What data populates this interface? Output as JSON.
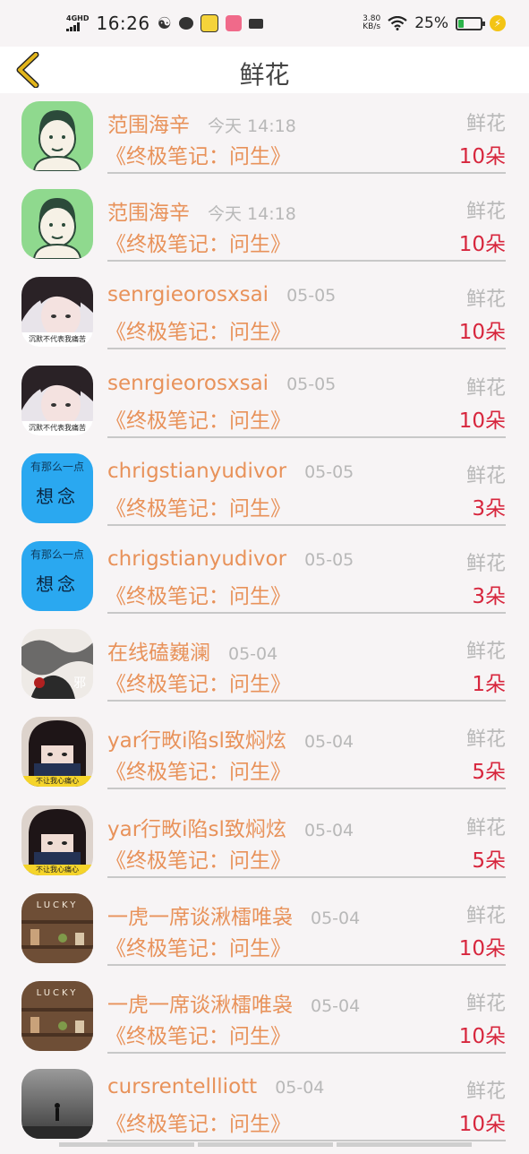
{
  "status": {
    "network": "4GHD",
    "time": "16:26",
    "speed_value": "3.80",
    "speed_unit": "KB/s",
    "battery_pct": "25%",
    "battery_level": 0.25
  },
  "header": {
    "title": "鲜花"
  },
  "rows": [
    {
      "nick": "范围海辛",
      "date": "今天 14:18",
      "type": "鲜花",
      "book": "《终极笔记：问生》",
      "count": "10朵",
      "avatar": "cartoon"
    },
    {
      "nick": "范围海辛",
      "date": "今天 14:18",
      "type": "鲜花",
      "book": "《终极笔记：问生》",
      "count": "10朵",
      "avatar": "cartoon"
    },
    {
      "nick": "senrgieorosxsai",
      "date": "05-05",
      "type": "鲜花",
      "book": "《终极笔记：问生》",
      "count": "10朵",
      "avatar": "girl"
    },
    {
      "nick": "senrgieorosxsai",
      "date": "05-05",
      "type": "鲜花",
      "book": "《终极笔记：问生》",
      "count": "10朵",
      "avatar": "girl"
    },
    {
      "nick": "chrigstianyudivor",
      "date": "05-05",
      "type": "鲜花",
      "book": "《终极笔记：问生》",
      "count": "3朵",
      "avatar": "blue"
    },
    {
      "nick": "chrigstianyudivor",
      "date": "05-05",
      "type": "鲜花",
      "book": "《终极笔记：问生》",
      "count": "3朵",
      "avatar": "blue"
    },
    {
      "nick": "在线磕巍澜",
      "date": "05-04",
      "type": "鲜花",
      "book": "《终极笔记：问生》",
      "count": "1朵",
      "avatar": "ink"
    },
    {
      "nick": "yar行畋i陷sl致焖炫",
      "date": "05-04",
      "type": "鲜花",
      "book": "《终极笔记：问生》",
      "count": "5朵",
      "avatar": "bangs"
    },
    {
      "nick": "yar行畋i陷sl致焖炫",
      "date": "05-04",
      "type": "鲜花",
      "book": "《终极笔记：问生》",
      "count": "5朵",
      "avatar": "bangs"
    },
    {
      "nick": "一虎一席谈湫檑唯袅",
      "date": "05-04",
      "type": "鲜花",
      "book": "《终极笔记：问生》",
      "count": "10朵",
      "avatar": "wood"
    },
    {
      "nick": "一虎一席谈湫檑唯袅",
      "date": "05-04",
      "type": "鲜花",
      "book": "《终极笔记：问生》",
      "count": "10朵",
      "avatar": "wood"
    },
    {
      "nick": "cursrentellliott",
      "date": "05-04",
      "type": "鲜花",
      "book": "《终极笔记：问生》",
      "count": "10朵",
      "avatar": "fog"
    }
  ],
  "avatar_text": {
    "girl": "沉默不代表我痛苦",
    "blue_top": "有那么一点",
    "blue_main": "想念",
    "ink": "邪",
    "bangs": "不让我心痛心",
    "wood": "LUCKY"
  },
  "colors": {
    "nick": "#e8925a",
    "count": "#d7263d",
    "muted": "#b8b8b8",
    "back_arrow": "#e2b51b"
  }
}
